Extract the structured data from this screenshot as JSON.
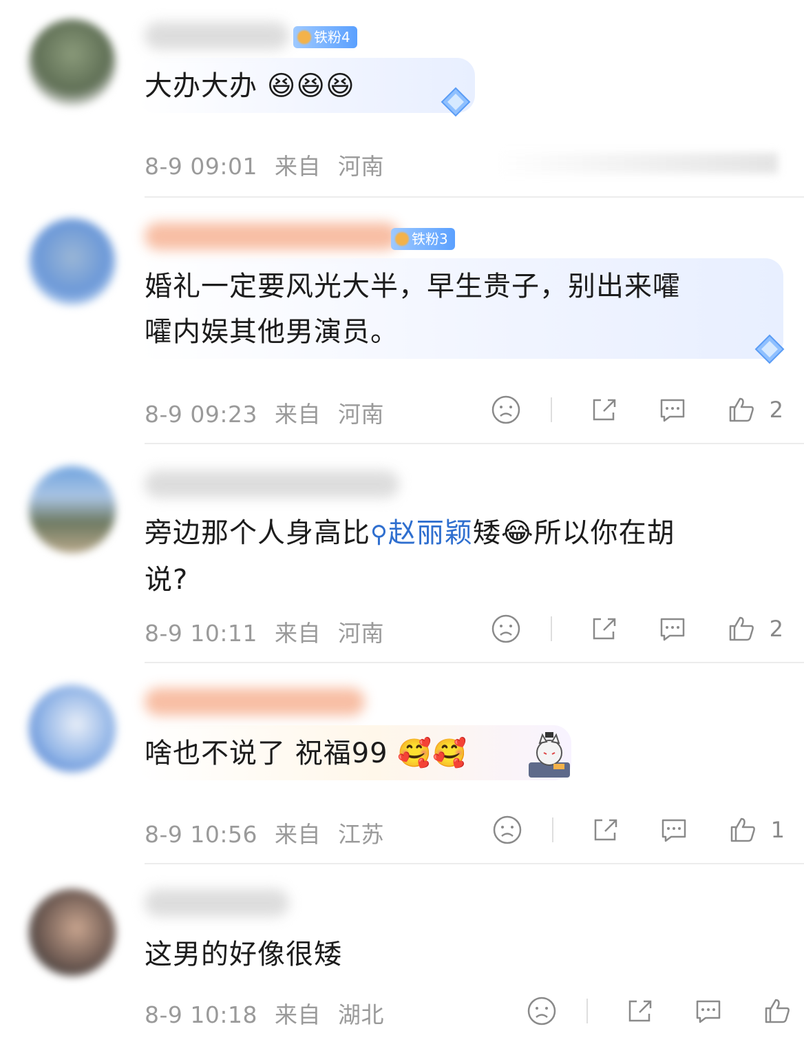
{
  "comments": [
    {
      "badge": "铁粉4",
      "text": "大办大办",
      "emoji": "😆😆😆",
      "time": "8-9 09:01",
      "from": "来自",
      "location": "河南",
      "likes": ""
    },
    {
      "badge": "铁粉3",
      "text_line1": "婚礼一定要风光大半，早生贵子，别出来嚯",
      "text_line2": "嚯内娱其他男演员。",
      "time": "8-9 09:23",
      "from": "来自",
      "location": "河南",
      "likes": "2"
    },
    {
      "text_pre": "旁边那个人身高比",
      "topic": "赵丽颖",
      "text_post": "矮",
      "emoji": "😂",
      "text_after_emoji": "所以你在胡",
      "text_line2": "说?",
      "time": "8-9 10:11",
      "from": "来自",
      "location": "河南",
      "likes": "2"
    },
    {
      "text": "啥也不说了 祝福99",
      "emoji": "🥰🥰",
      "time": "8-9 10:56",
      "from": "来自",
      "location": "江苏",
      "likes": "1"
    },
    {
      "text": "这男的好像很矮",
      "time": "8-9 10:18",
      "from": "来自",
      "location": "湖北",
      "likes": ""
    }
  ],
  "icons": {
    "dislike": "sad-face-icon",
    "share": "share-icon",
    "reply": "comment-icon",
    "like": "thumbs-up-icon"
  },
  "colors": {
    "topic": "#2f6fcf",
    "meta": "#9a9a9a",
    "badge": "#5aa0ff"
  }
}
